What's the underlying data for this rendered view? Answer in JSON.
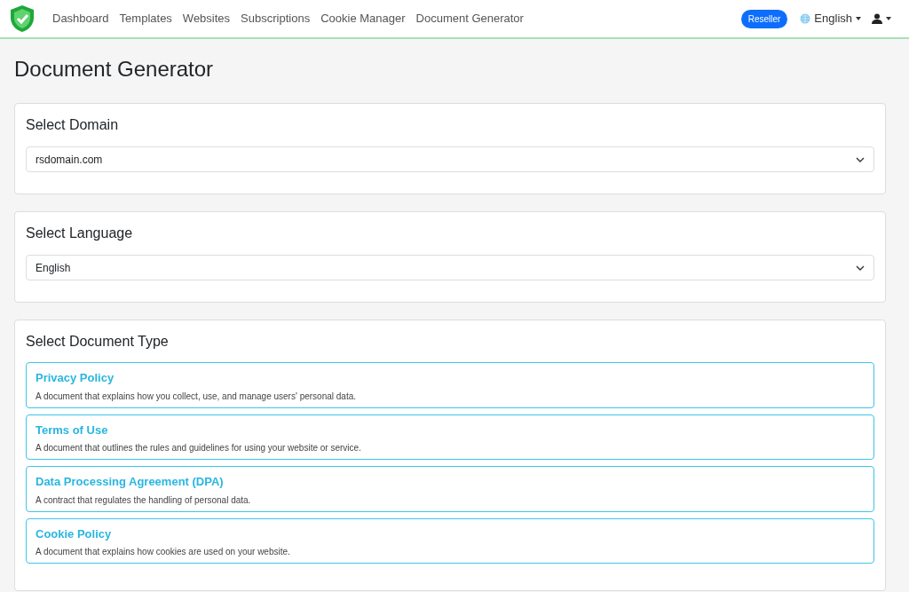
{
  "navbar": {
    "links": [
      "Dashboard",
      "Templates",
      "Websites",
      "Subscriptions",
      "Cookie Manager",
      "Document Generator"
    ],
    "badge": "Reseller",
    "language": "English"
  },
  "page_title": "Document Generator",
  "domain_card": {
    "title": "Select Domain",
    "value": "rsdomain.com"
  },
  "language_card": {
    "title": "Select Language",
    "value": "English"
  },
  "document_card": {
    "title": "Select Document Type",
    "options": [
      {
        "title": "Privacy Policy",
        "description": "A document that explains how you collect, use, and manage users' personal data."
      },
      {
        "title": "Terms of Use",
        "description": "A document that outlines the rules and guidelines for using your website or service."
      },
      {
        "title": "Data Processing Agreement (DPA)",
        "description": "A contract that regulates the handling of personal data."
      },
      {
        "title": "Cookie Policy",
        "description": "A document that explains how cookies are used on your website."
      }
    ]
  }
}
